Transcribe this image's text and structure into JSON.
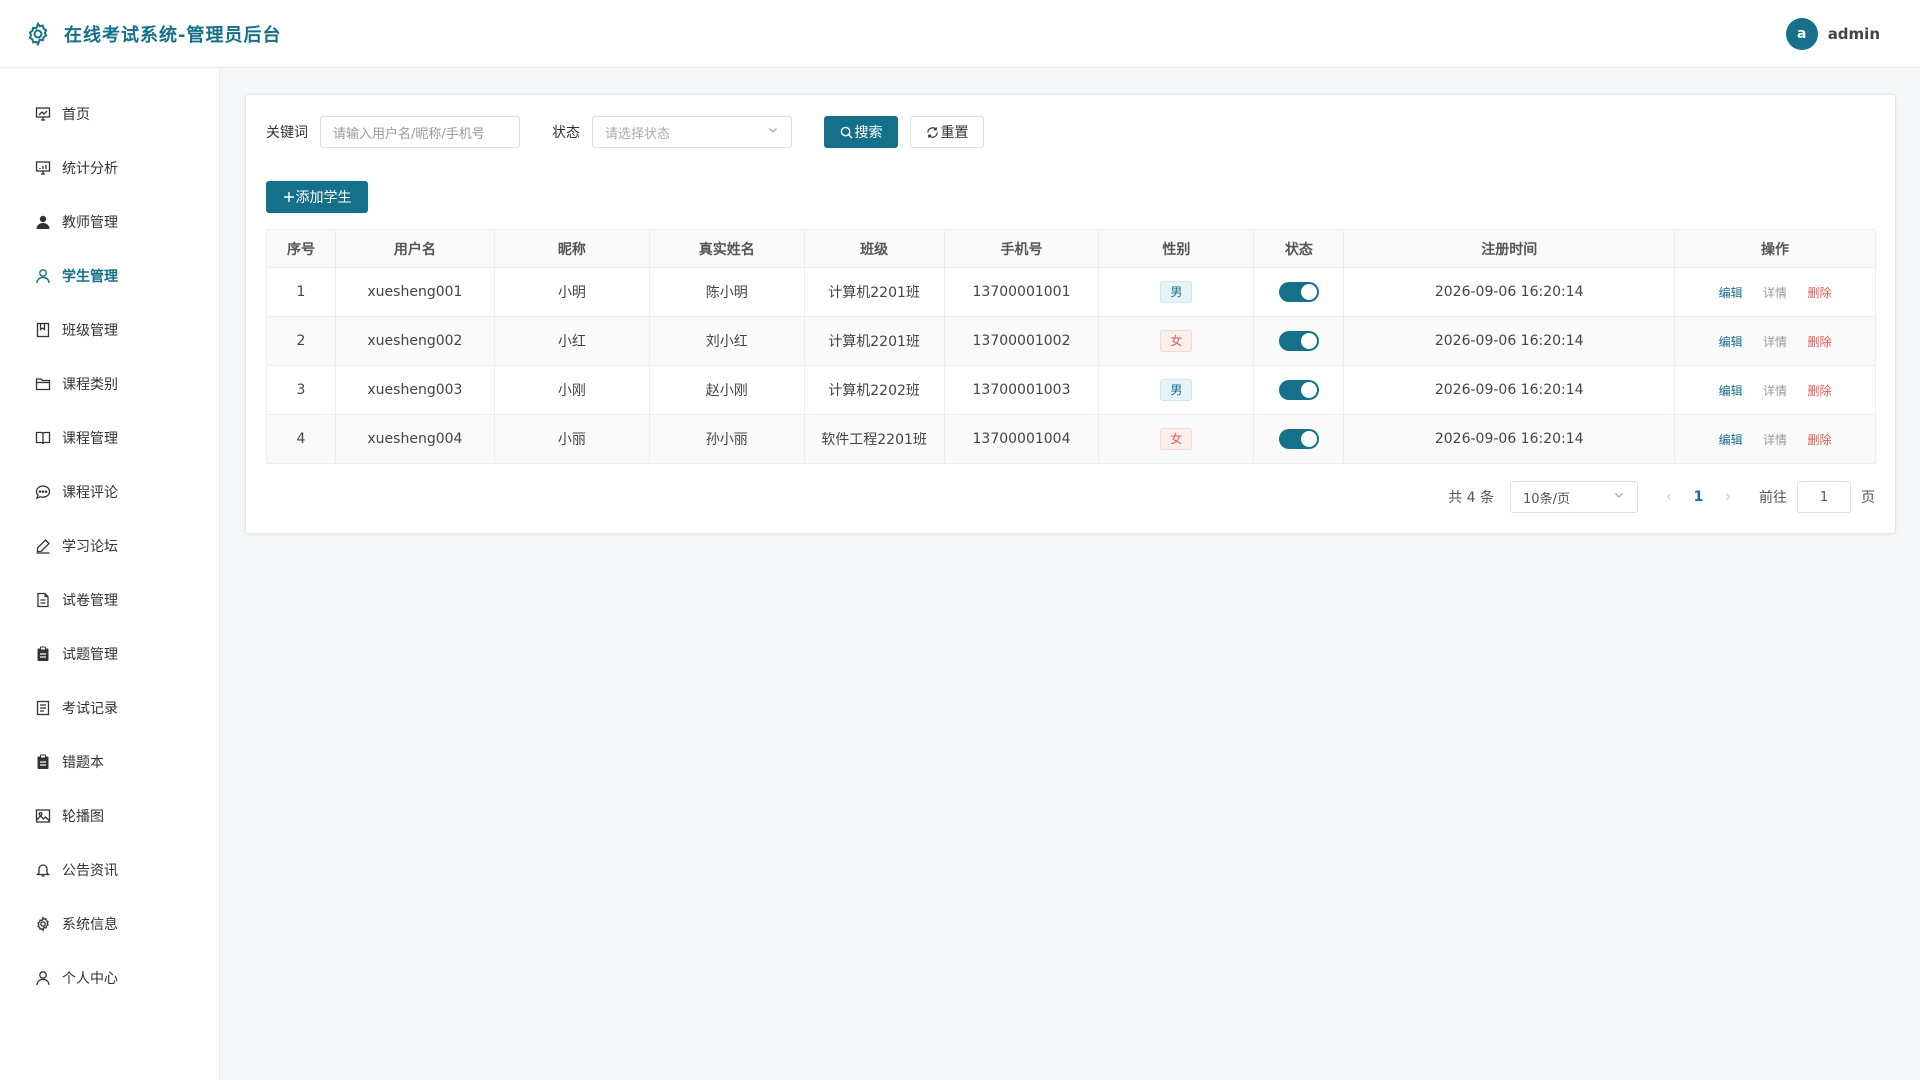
{
  "header": {
    "title": "在线考试系统-管理员后台",
    "avatar_letter": "a",
    "username": "admin"
  },
  "colors": {
    "primary": "#15708a",
    "danger": "#e05b5b"
  },
  "sidebar": {
    "items": [
      {
        "label": "首页",
        "icon": "dashboard-icon"
      },
      {
        "label": "统计分析",
        "icon": "chart-icon"
      },
      {
        "label": "教师管理",
        "icon": "user-filled-icon"
      },
      {
        "label": "学生管理",
        "icon": "user-icon",
        "active": true
      },
      {
        "label": "班级管理",
        "icon": "bookmark-icon"
      },
      {
        "label": "课程类别",
        "icon": "folder-icon"
      },
      {
        "label": "课程管理",
        "icon": "book-icon"
      },
      {
        "label": "课程评论",
        "icon": "chat-icon"
      },
      {
        "label": "学习论坛",
        "icon": "edit-pen-icon"
      },
      {
        "label": "试卷管理",
        "icon": "document-icon"
      },
      {
        "label": "试题管理",
        "icon": "clipboard-icon"
      },
      {
        "label": "考试记录",
        "icon": "record-icon"
      },
      {
        "label": "错题本",
        "icon": "notebook-icon"
      },
      {
        "label": "轮播图",
        "icon": "picture-icon"
      },
      {
        "label": "公告资讯",
        "icon": "bell-icon"
      },
      {
        "label": "系统信息",
        "icon": "gear-icon"
      },
      {
        "label": "个人中心",
        "icon": "person-icon"
      }
    ]
  },
  "filter": {
    "keyword_label": "关键词",
    "keyword_placeholder": "请输入用户名/昵称/手机号",
    "status_label": "状态",
    "status_placeholder": "请选择状态",
    "search_label": "搜索",
    "reset_label": "重置"
  },
  "add_button_label": "添加学生",
  "table": {
    "headers": [
      "序号",
      "用户名",
      "昵称",
      "真实姓名",
      "班级",
      "手机号",
      "性别",
      "状态",
      "注册时间",
      "操作"
    ],
    "rows": [
      {
        "no": "1",
        "username": "xuesheng001",
        "nickname": "小明",
        "realname": "陈小明",
        "class": "计算机2201班",
        "phone": "13700001001",
        "gender": "男",
        "enabled": true,
        "time": "2026-09-06 16:20:14"
      },
      {
        "no": "2",
        "username": "xuesheng002",
        "nickname": "小红",
        "realname": "刘小红",
        "class": "计算机2201班",
        "phone": "13700001002",
        "gender": "女",
        "enabled": true,
        "time": "2026-09-06 16:20:14"
      },
      {
        "no": "3",
        "username": "xuesheng003",
        "nickname": "小刚",
        "realname": "赵小刚",
        "class": "计算机2202班",
        "phone": "13700001003",
        "gender": "男",
        "enabled": true,
        "time": "2026-09-06 16:20:14"
      },
      {
        "no": "4",
        "username": "xuesheng004",
        "nickname": "小丽",
        "realname": "孙小丽",
        "class": "软件工程2201班",
        "phone": "13700001004",
        "gender": "女",
        "enabled": true,
        "time": "2026-09-06 16:20:14"
      }
    ],
    "actions": {
      "edit": "编辑",
      "detail": "详情",
      "delete": "删除"
    }
  },
  "pagination": {
    "total_text": "共 4 条",
    "page_size": "10条/页",
    "current_page": "1",
    "goto_label": "前往",
    "goto_value": "1",
    "page_suffix": "页"
  }
}
